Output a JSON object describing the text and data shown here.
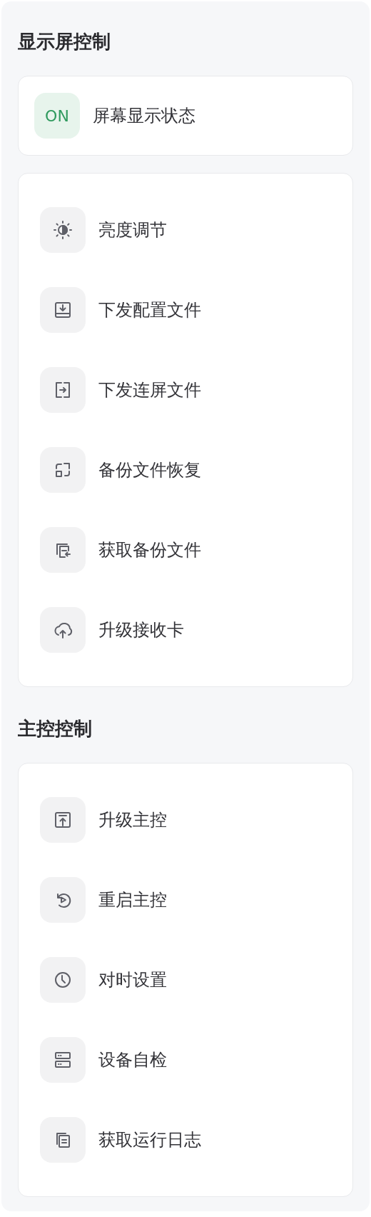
{
  "sections": [
    {
      "title": "显示屏控制",
      "status": {
        "badge": "ON",
        "on": true,
        "label": "屏幕显示状态"
      },
      "items": [
        {
          "kind": "brightness",
          "label": "亮度调节"
        },
        {
          "kind": "download",
          "label": "下发配置文件"
        },
        {
          "kind": "splice",
          "label": "下发连屏文件"
        },
        {
          "kind": "restore",
          "label": "备份文件恢复"
        },
        {
          "kind": "fetch",
          "label": "获取备份文件"
        },
        {
          "kind": "cloud",
          "label": "升级接收卡"
        }
      ]
    },
    {
      "title": "主控控制",
      "items": [
        {
          "kind": "upload",
          "label": "升级主控"
        },
        {
          "kind": "restart",
          "label": "重启主控"
        },
        {
          "kind": "clock",
          "label": "对时设置"
        },
        {
          "kind": "server",
          "label": "设备自检"
        },
        {
          "kind": "logs",
          "label": "获取运行日志"
        }
      ]
    }
  ]
}
